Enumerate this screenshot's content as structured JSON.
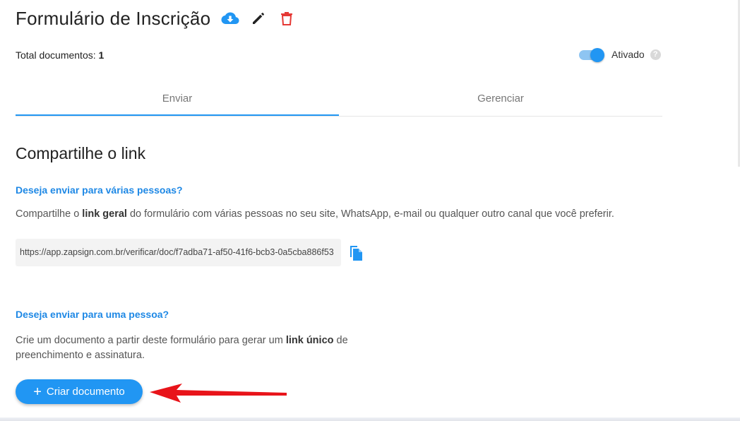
{
  "header": {
    "title": "Formulário de Inscrição",
    "icons": [
      "cloud-download-icon",
      "pencil-icon",
      "trash-icon"
    ]
  },
  "summary": {
    "total_label": "Total documentos:",
    "total_value": "1"
  },
  "status_toggle": {
    "label": "Ativado",
    "enabled": true,
    "help_glyph": "?"
  },
  "tabs": [
    {
      "label": "Enviar",
      "active": true
    },
    {
      "label": "Gerenciar",
      "active": false
    }
  ],
  "share": {
    "title": "Compartilhe o link",
    "multi": {
      "question": "Deseja enviar para várias pessoas?",
      "text_before": "Compartilhe o ",
      "text_bold": "link geral",
      "text_after": " do formulário com várias pessoas no seu site, WhatsApp, e-mail ou qualquer outro canal que você preferir.",
      "link": "https://app.zapsign.com.br/verificar/doc/f7adba71-af50-41f6-bcb3-0a5cba886f53"
    },
    "single": {
      "question": "Deseja enviar para uma pessoa?",
      "text_before": "Crie um documento a partir deste formulário para gerar um ",
      "text_bold": "link único",
      "text_after": " de preenchimento e assinatura.",
      "button_label": "Criar documento",
      "button_icon": "+"
    }
  },
  "colors": {
    "accent": "#2196f3",
    "delete": "#e53935",
    "annotation_arrow": "#e8141a"
  }
}
